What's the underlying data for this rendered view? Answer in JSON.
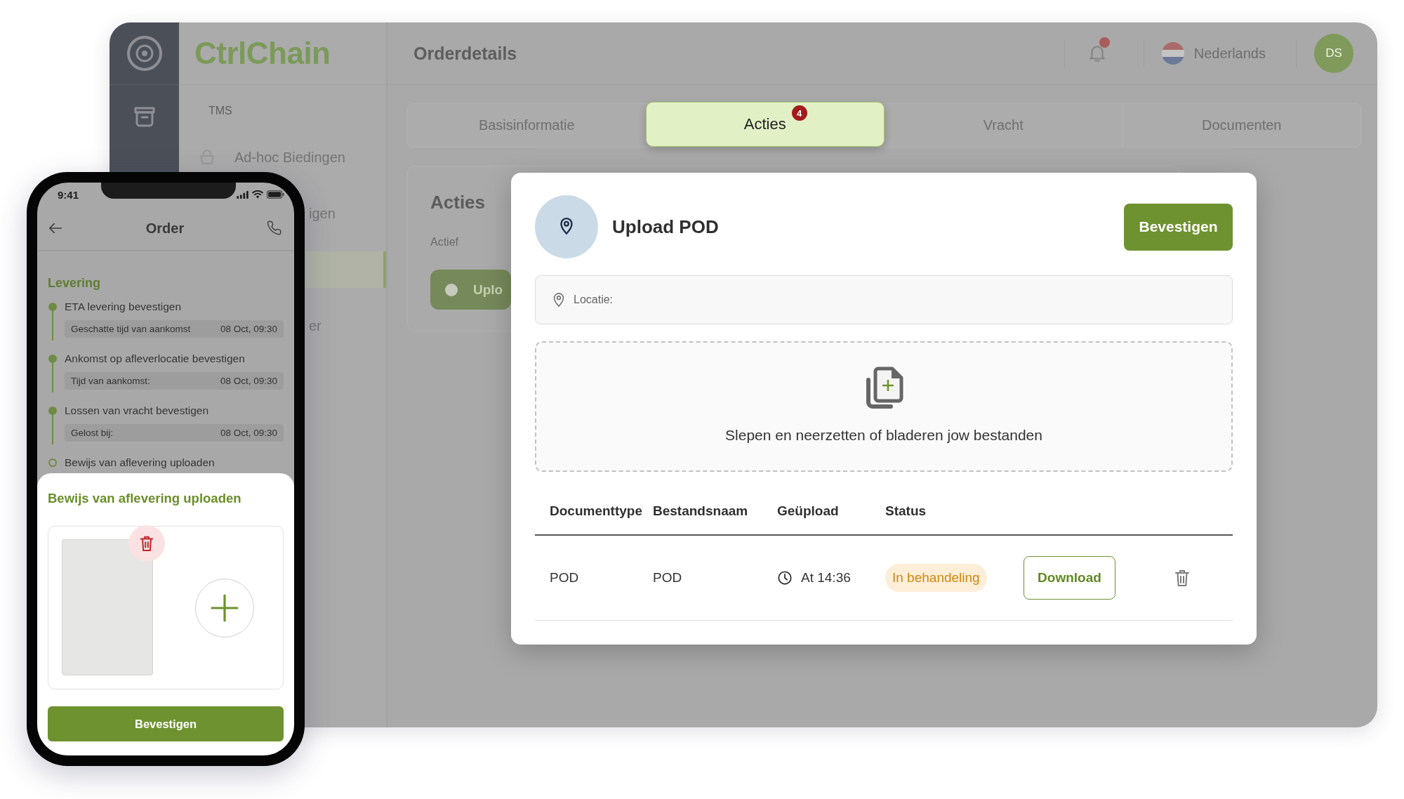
{
  "desktop": {
    "brand": "CtrlChain",
    "sidebar": {
      "section": "TMS",
      "items": [
        {
          "label": "Ad-hoc Biedingen",
          "kind": "full",
          "selected": false
        },
        {
          "label": "igen",
          "kind": "clipped",
          "selected": false
        },
        {
          "kind": "clipped",
          "selected": true
        },
        {
          "label": "er",
          "kind": "clipped",
          "selected": false
        }
      ]
    },
    "header": {
      "title": "Orderdetails",
      "unread": true,
      "language": "Nederlands",
      "avatar": "DS"
    },
    "tabs": [
      {
        "label": "Basisinformatie",
        "selected": false
      },
      {
        "label": "Acties",
        "selected": true,
        "badge": "4"
      },
      {
        "label": "Vracht",
        "selected": false
      },
      {
        "label": "Documenten",
        "selected": false
      }
    ],
    "actions_card": {
      "title": "Acties",
      "status": "Actief",
      "button": "Uplo"
    }
  },
  "dialog": {
    "title": "Upload POD",
    "confirm_button": "Bevestigen",
    "location": {
      "placeholder": "Locatie:"
    },
    "dropzone": {
      "text": "Slepen en neerzetten of bladeren jow bestanden"
    },
    "table": {
      "columns": [
        "Documenttype",
        "Bestandsnaam",
        "Geüpload",
        "Status"
      ],
      "rows": [
        {
          "document_type": "POD",
          "file_name": "POD",
          "uploaded": "At 14:36",
          "status": "In behandeling",
          "action": "Download"
        }
      ]
    }
  },
  "phone": {
    "status_bar": {
      "time": "9:41"
    },
    "title": "Order",
    "section": "Levering",
    "steps": [
      {
        "title": "ETA levering bevestigen",
        "done": true,
        "detail_label": "Geschatte tijd van aankomst",
        "detail_value": "08 Oct, 09:30"
      },
      {
        "title": "Ankomst op afleverlocatie bevestigen",
        "done": true,
        "detail_label": "Tijd van aankomst:",
        "detail_value": "08 Oct, 09:30"
      },
      {
        "title": "Lossen van vracht bevestigen",
        "done": true,
        "detail_label": "Gelost bij:",
        "detail_value": "08 Oct, 09:30"
      },
      {
        "title": "Bewijs van aflevering uploaden",
        "done": false
      }
    ],
    "sheet": {
      "title": "Bewijs van aflevering uploaden",
      "button": "Bevestigen"
    }
  }
}
